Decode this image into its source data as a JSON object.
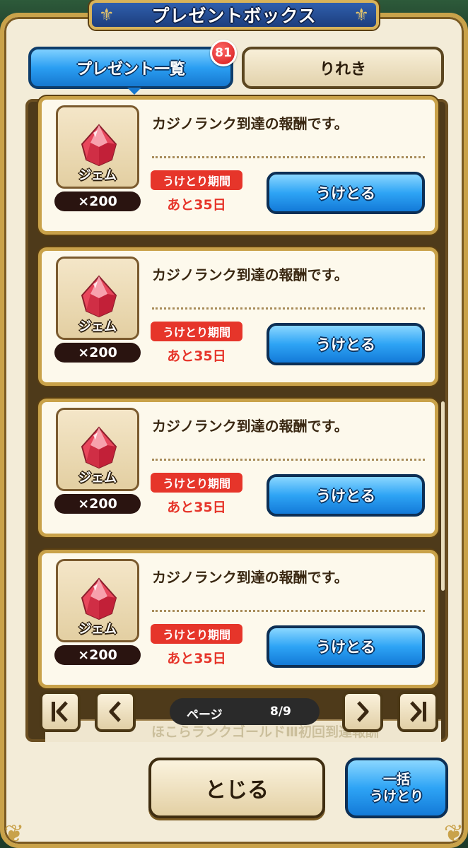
{
  "window": {
    "title": "プレゼントボックス"
  },
  "tabs": {
    "present_list": "プレゼント一覧",
    "history": "りれき",
    "badge_count": "81"
  },
  "items": [
    {
      "name": "ジェム",
      "quantity": "×200",
      "message": "カジノランク到達の報酬です。",
      "period_label": "うけとり期間",
      "remaining": "あと35日",
      "button": "うけとる"
    },
    {
      "name": "ジェム",
      "quantity": "×200",
      "message": "カジノランク到達の報酬です。",
      "period_label": "うけとり期間",
      "remaining": "あと35日",
      "button": "うけとる"
    },
    {
      "name": "ジェム",
      "quantity": "×200",
      "message": "カジノランク到達の報酬です。",
      "period_label": "うけとり期間",
      "remaining": "あと35日",
      "button": "うけとる"
    },
    {
      "name": "ジェム",
      "quantity": "×200",
      "message": "カジノランク到達の報酬です。",
      "period_label": "うけとり期間",
      "remaining": "あと35日",
      "button": "うけとる"
    }
  ],
  "pager": {
    "label": "ページ",
    "value": "8/9",
    "obscured_text": "ほこらランクゴールドⅢ初回到達報酬"
  },
  "footer": {
    "close": "とじる",
    "bulk_line1": "一括",
    "bulk_line2": "うけとり"
  },
  "colors": {
    "accent_blue": "#2ea4f5",
    "gold": "#c9a24a",
    "alert_red": "#e6352a",
    "gem": "#e8475c"
  },
  "icons": [
    "gem-icon",
    "first-page-icon",
    "prev-page-icon",
    "next-page-icon",
    "last-page-icon"
  ]
}
